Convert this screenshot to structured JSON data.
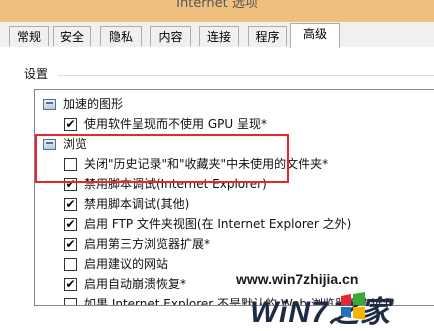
{
  "window": {
    "title": "Internet 选项"
  },
  "tabs": [
    {
      "label": "常规"
    },
    {
      "label": "安全"
    },
    {
      "label": "隐私"
    },
    {
      "label": "内容"
    },
    {
      "label": "连接"
    },
    {
      "label": "程序"
    },
    {
      "label": "高级",
      "active": true
    }
  ],
  "settings": {
    "label": "设置",
    "items": [
      {
        "type": "category",
        "label": "加速的图形"
      },
      {
        "type": "checkbox",
        "checked": true,
        "label": "使用软件呈现而不使用 GPU 呈现*"
      },
      {
        "type": "category",
        "label": "浏览"
      },
      {
        "type": "checkbox",
        "checked": false,
        "label": "关闭\"历史记录\"和\"收藏夹\"中未使用的文件夹*"
      },
      {
        "type": "checkbox",
        "checked": true,
        "label": "禁用脚本调试(Internet Explorer)"
      },
      {
        "type": "checkbox",
        "checked": true,
        "label": "禁用脚本调试(其他)"
      },
      {
        "type": "checkbox",
        "checked": true,
        "label": "启用 FTP 文件夹视图(在 Internet Explorer 之外)"
      },
      {
        "type": "checkbox",
        "checked": true,
        "label": "启用第三方浏览器扩展*"
      },
      {
        "type": "checkbox",
        "checked": false,
        "label": "启用建议的网站"
      },
      {
        "type": "checkbox",
        "checked": true,
        "label": "启用自动崩溃恢复*"
      },
      {
        "type": "checkbox",
        "checked": false,
        "label": "如果 Internet Explorer 不是默认的 Web 浏览器则告诉我"
      }
    ]
  },
  "watermark": {
    "url": "www.win7zhijia.cn",
    "brand": "WiN7之家"
  },
  "colors": {
    "highlight": "#e8262c",
    "watermark_logo": [
      "#e8262c",
      "#3aa935",
      "#1e73c8",
      "#f2b600"
    ]
  }
}
